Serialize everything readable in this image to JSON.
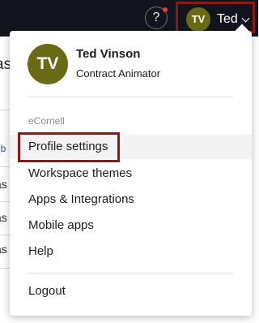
{
  "topbar": {
    "help_icon": "?",
    "user_initials": "TV",
    "user_short_name": "Ted"
  },
  "background": {
    "fragments": [
      "as",
      "ub",
      "as",
      "as",
      "as"
    ]
  },
  "dropdown": {
    "avatar_initials": "TV",
    "full_name": "Ted Vinson",
    "role": "Contract Animator",
    "workspace_label": "eCornell",
    "items": [
      {
        "label": "Profile settings"
      },
      {
        "label": "Workspace themes"
      },
      {
        "label": "Apps & Integrations"
      },
      {
        "label": "Mobile apps"
      },
      {
        "label": "Help"
      }
    ],
    "logout_label": "Logout"
  },
  "colors": {
    "topbar_bg": "#12151d",
    "avatar": "#6b6a14",
    "highlight_outline": "#8b1a15",
    "notification": "#e0413a"
  }
}
